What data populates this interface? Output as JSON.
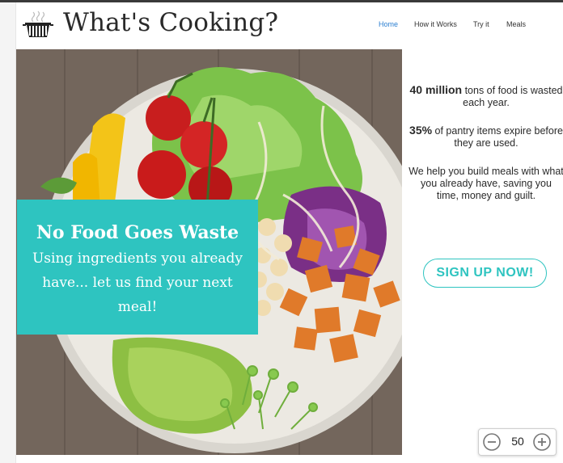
{
  "header": {
    "brand": "What's Cooking?",
    "nav": [
      {
        "label": "Home",
        "active": true
      },
      {
        "label": "How it Works",
        "active": false
      },
      {
        "label": "Try it",
        "active": false
      },
      {
        "label": "Meals",
        "active": false
      }
    ]
  },
  "hero": {
    "title": "No Food Goes Waste",
    "subtitle": "Using ingredients you already have... let us find your next meal!"
  },
  "sidebar": {
    "stat1_number": "40 million",
    "stat1_text": " tons of food is wasted each year.",
    "stat2_number": "35%",
    "stat2_text": " of pantry items expire before they are used.",
    "pitch": "We help you build meals with what you already have, saving you time, money and guilt.",
    "signup_label": "SIGN UP NOW!"
  },
  "zoom": {
    "value": "50"
  },
  "colors": {
    "accent": "#2ec4c0",
    "nav_active": "#2b7fd1",
    "text": "#2a2a2a"
  },
  "icons": [
    "cooking-pot-logo-icon",
    "zoom-out-icon",
    "zoom-in-icon"
  ]
}
